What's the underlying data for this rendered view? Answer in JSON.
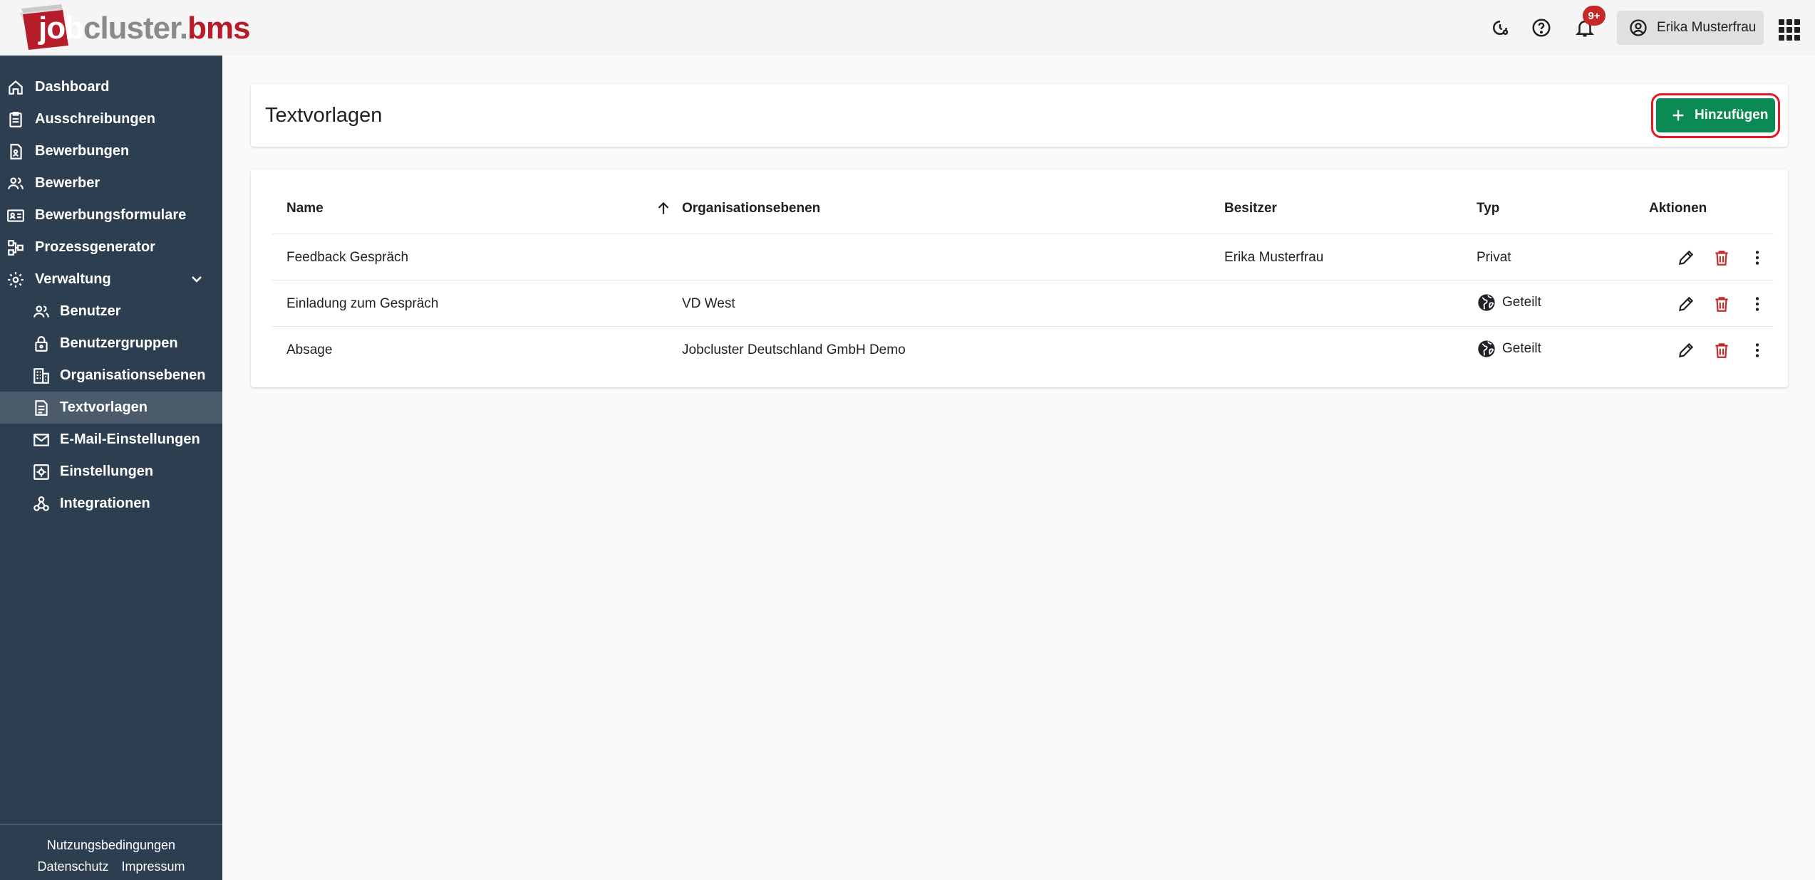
{
  "app": {
    "logo_parts": [
      "job",
      "cluster",
      ".",
      "bms"
    ]
  },
  "topbar": {
    "badge": "9+",
    "user_name": "Erika Musterfrau"
  },
  "sidebar": {
    "items": [
      {
        "label": "Dashboard",
        "icon": "home-icon"
      },
      {
        "label": "Ausschreibungen",
        "icon": "clipboard-icon"
      },
      {
        "label": "Bewerbungen",
        "icon": "document-person-icon"
      },
      {
        "label": "Bewerber",
        "icon": "people-icon"
      },
      {
        "label": "Bewerbungsformulare",
        "icon": "id-card-icon"
      },
      {
        "label": "Prozessgenerator",
        "icon": "process-icon"
      },
      {
        "label": "Verwaltung",
        "icon": "gear-icon"
      }
    ],
    "subitems": [
      {
        "label": "Benutzer",
        "icon": "people-icon"
      },
      {
        "label": "Benutzergruppen",
        "icon": "lock-icon"
      },
      {
        "label": "Organisationsebenen",
        "icon": "building-icon"
      },
      {
        "label": "Textvorlagen",
        "icon": "text-document-icon",
        "active": true
      },
      {
        "label": "E-Mail-Einstellungen",
        "icon": "mail-icon"
      },
      {
        "label": "Einstellungen",
        "icon": "settings-box-icon"
      },
      {
        "label": "Integrationen",
        "icon": "webhook-icon"
      }
    ],
    "footer": {
      "terms": "Nutzungsbedingungen",
      "privacy": "Datenschutz",
      "imprint": "Impressum"
    }
  },
  "page": {
    "title": "Textvorlagen",
    "add_label": "Hinzufügen"
  },
  "table": {
    "columns": [
      "Name",
      "Organisationsebenen",
      "Besitzer",
      "Typ",
      "Aktionen"
    ],
    "rows": [
      {
        "name": "Feedback Gespräch",
        "org": "",
        "owner": "Erika Musterfrau",
        "type": "Privat",
        "globe": false
      },
      {
        "name": "Einladung zum Gespräch",
        "org": "VD West",
        "owner": "",
        "type": "Geteilt",
        "globe": true
      },
      {
        "name": "Absage",
        "org": "Jobcluster Deutschland GmbH Demo",
        "owner": "",
        "type": "Geteilt",
        "globe": true
      }
    ]
  },
  "colors": {
    "sidebar_bg": "#2d3e50",
    "sidebar_active": "#4b5b6c",
    "primary_button": "#0b8a55",
    "delete_icon": "#c62828",
    "brand_red": "#b71c2b",
    "highlight_ring": "#e21b23"
  }
}
